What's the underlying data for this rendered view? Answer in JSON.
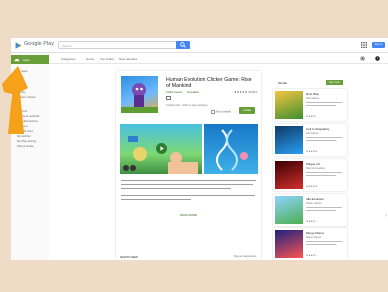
{
  "colors": {
    "background": "#efdcc6",
    "accent_green": "#689f38",
    "accent_blue": "#4285f4",
    "arrow": "#f5a21a"
  },
  "header": {
    "brand": "Google Play",
    "search_placeholder": "Search",
    "sign_in": "Sign in"
  },
  "sidebar": {
    "active": "Apps",
    "items": [
      "My apps",
      "Shop",
      "Games",
      "Family",
      "Editors' Choice",
      "Account",
      "Payment methods",
      "My subscriptions",
      "Redeem",
      "Buy gift card",
      "My wishlist",
      "My Play activity",
      "Parent Guide"
    ]
  },
  "subnav": {
    "items": [
      "Categories",
      "Home",
      "Top charts",
      "New releases"
    ]
  },
  "app": {
    "title": "Human Evolution Clicker Game: Rise of Mankind",
    "developer": "Kolibri Games",
    "category": "Simulation",
    "rating_stars": "★★★★★",
    "rating_count": "65,817",
    "contains": "Contains Ads · Offers in-app purchases",
    "wishlist": "Add to wishlist",
    "install": "Install",
    "read_more": "READ MORE",
    "whats_new": "WHAT'S NEW",
    "flag": "Flag as inappropriate"
  },
  "similar": {
    "title": "Similar",
    "see_more": "See more",
    "items": [
      {
        "name": "Dino Rise",
        "dev": "Dino Games",
        "stars": "★★★★☆"
      },
      {
        "name": "Cell to Singularity",
        "dev": "Lab Games",
        "stars": "★★★★★"
      },
      {
        "name": "Plague Inc.",
        "dev": "Ndemic Creations",
        "stars": "★★★★★"
      },
      {
        "name": "Idle Evolution",
        "dev": "Clicker Games",
        "stars": "★★★★☆"
      },
      {
        "name": "Merge Planet",
        "dev": "Space Games",
        "stars": "★★★★☆"
      }
    ]
  }
}
